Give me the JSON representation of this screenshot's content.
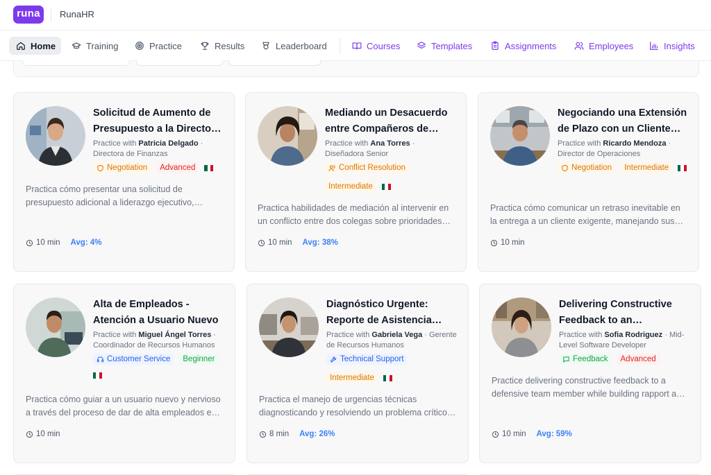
{
  "app": {
    "logo": "runa",
    "name": "RunaHR"
  },
  "nav": [
    {
      "label": "Home",
      "icon": "home-icon",
      "active": true
    },
    {
      "label": "Training",
      "icon": "graduation-cap-icon"
    },
    {
      "label": "Practice",
      "icon": "target-icon"
    },
    {
      "label": "Results",
      "icon": "trophy-icon"
    },
    {
      "label": "Leaderboard",
      "icon": "award-icon"
    },
    {
      "label": "Courses",
      "icon": "book-open-icon"
    },
    {
      "label": "Templates",
      "icon": "layers-icon"
    },
    {
      "label": "Assignments",
      "icon": "clipboard-icon"
    },
    {
      "label": "Employees",
      "icon": "users-icon"
    },
    {
      "label": "Insights",
      "icon": "bar-chart-icon"
    }
  ],
  "colors": {
    "brand": "#7c3aed",
    "avg": "#3b82f6"
  },
  "cards": [
    {
      "title": "Solicitud de Aumento de Presupuesto a la Directora de Finanzas",
      "practice_prefix": "Practice with",
      "persona": "Patricia Delgado",
      "role": "Directora de Finanzas",
      "tags": [
        {
          "label": "Negotiation",
          "style": "orange",
          "icon": "shield-icon"
        },
        {
          "label": "Advanced",
          "style": "red"
        }
      ],
      "description": "Practica cómo presentar una solicitud de presupuesto adicional a liderazgo ejecutivo, justificando el retorno de inversión.",
      "duration": "10 min",
      "avg": "Avg: 4%"
    },
    {
      "title": "Mediando un Desacuerdo entre Compañeros de Trabajo",
      "practice_prefix": "Practice with",
      "persona": "Ana Torres",
      "role": "Diseñadora Senior",
      "tags": [
        {
          "label": "Conflict Resolution",
          "style": "orange",
          "icon": "users-icon"
        },
        {
          "label": "Intermediate",
          "style": "orange"
        }
      ],
      "description": "Practica habilidades de mediación al intervenir en un conflicto entre dos colegas sobre prioridades del proyecto.",
      "duration": "10 min",
      "avg": "Avg: 38%"
    },
    {
      "title": "Negociando una Extensión de Plazo con un Cliente Exigente",
      "practice_prefix": "Practice with",
      "persona": "Ricardo Mendoza",
      "role": "Director de Operaciones",
      "tags": [
        {
          "label": "Negotiation",
          "style": "orange",
          "icon": "shield-icon"
        },
        {
          "label": "Intermediate",
          "style": "orange"
        }
      ],
      "description": "Practica cómo comunicar un retraso inevitable en la entrega a un cliente exigente, manejando sus expectativas.",
      "duration": "10 min",
      "avg": ""
    },
    {
      "title": "Alta de Empleados - Atención a Usuario Nuevo",
      "practice_prefix": "Practice with",
      "persona": "Miguel Ángel Torres",
      "role": "Coordinador de Recursos Humanos",
      "tags": [
        {
          "label": "Customer Service",
          "style": "blue",
          "icon": "headset-icon"
        },
        {
          "label": "Beginner",
          "style": "green"
        }
      ],
      "description": "Practica cómo guiar a un usuario nuevo y nervioso a través del proceso de dar de alta empleados en el sistema.",
      "duration": "10 min",
      "avg": ""
    },
    {
      "title": "Diagnóstico Urgente: Reporte de Asistencia Bloqueado",
      "practice_prefix": "Practice with",
      "persona": "Gabriela Vega",
      "role": "Gerente de Recursos Humanos",
      "tags": [
        {
          "label": "Technical Support",
          "style": "blue",
          "icon": "wrench-icon"
        },
        {
          "label": "Intermediate",
          "style": "orange"
        }
      ],
      "description": "Practica el manejo de urgencias técnicas diagnosticando y resolviendo un problema crítico bajo presión.",
      "duration": "8 min",
      "avg": "Avg: 26%"
    },
    {
      "title": "Delivering Constructive Feedback to an Underperforming Team Member",
      "practice_prefix": "Practice with",
      "persona": "Sofia Rodriguez",
      "role": "Mid-Level Software Developer",
      "tags": [
        {
          "label": "Feedback",
          "style": "green",
          "icon": "message-icon"
        },
        {
          "label": "Advanced",
          "style": "red"
        }
      ],
      "description": "Practice delivering constructive feedback to a defensive team member while building rapport and trust.",
      "duration": "10 min",
      "avg": "Avg: 59%"
    }
  ]
}
